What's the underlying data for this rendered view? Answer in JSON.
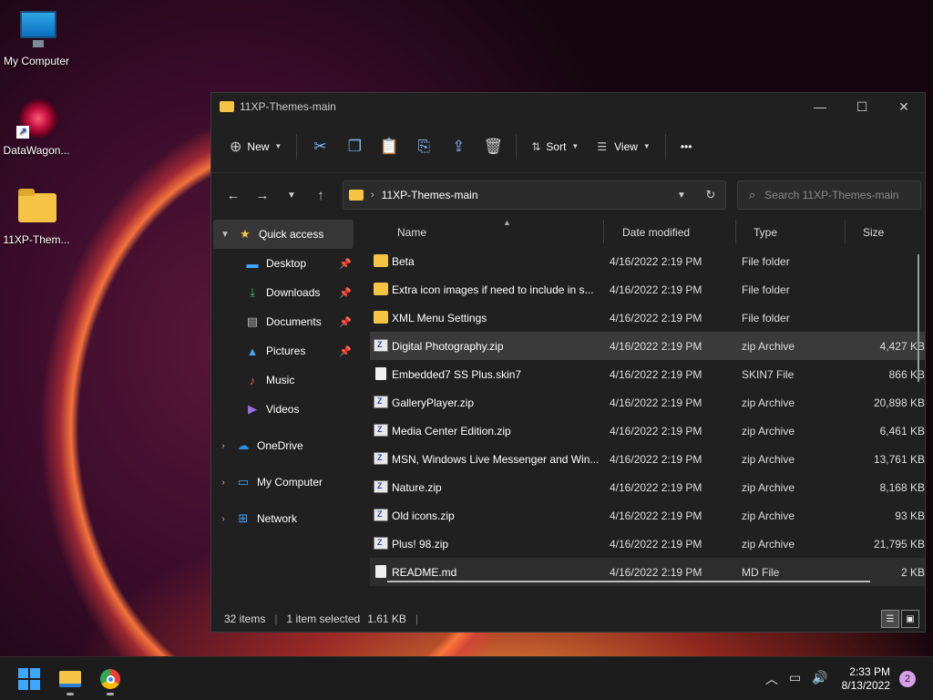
{
  "desktop": {
    "icons": [
      {
        "label": "My Computer"
      },
      {
        "label": "DataWagon..."
      },
      {
        "label": "11XP-Them..."
      }
    ]
  },
  "window": {
    "title": "11XP-Themes-main",
    "controls": {
      "minimize": "—",
      "maximize": "☐",
      "close": "✕"
    }
  },
  "toolbar": {
    "new_label": "New",
    "sort_label": "Sort",
    "view_label": "View",
    "more_label": "•••"
  },
  "address": {
    "path": "11XP-Themes-main",
    "search_placeholder": "Search 11XP-Themes-main"
  },
  "nav": {
    "quick_access": "Quick access",
    "pinned": [
      {
        "label": "Desktop"
      },
      {
        "label": "Downloads"
      },
      {
        "label": "Documents"
      },
      {
        "label": "Pictures"
      },
      {
        "label": "Music"
      },
      {
        "label": "Videos"
      }
    ],
    "onedrive": "OneDrive",
    "my_computer": "My Computer",
    "network": "Network"
  },
  "columns": {
    "name": "Name",
    "date": "Date modified",
    "type": "Type",
    "size": "Size"
  },
  "files": [
    {
      "name": "Beta",
      "date": "4/16/2022 2:19 PM",
      "type": "File folder",
      "size": ""
    },
    {
      "name": "Extra icon  images if need to include in s...",
      "date": "4/16/2022 2:19 PM",
      "type": "File folder",
      "size": ""
    },
    {
      "name": "XML Menu Settings",
      "date": "4/16/2022 2:19 PM",
      "type": "File folder",
      "size": ""
    },
    {
      "name": "Digital Photography.zip",
      "date": "4/16/2022 2:19 PM",
      "type": "zip Archive",
      "size": "4,427 KB"
    },
    {
      "name": "Embedded7 SS Plus.skin7",
      "date": "4/16/2022 2:19 PM",
      "type": "SKIN7 File",
      "size": "866 KB"
    },
    {
      "name": "GalleryPlayer.zip",
      "date": "4/16/2022 2:19 PM",
      "type": "zip Archive",
      "size": "20,898 KB"
    },
    {
      "name": "Media Center Edition.zip",
      "date": "4/16/2022 2:19 PM",
      "type": "zip Archive",
      "size": "6,461 KB"
    },
    {
      "name": "MSN, Windows Live Messenger and Win...",
      "date": "4/16/2022 2:19 PM",
      "type": "zip Archive",
      "size": "13,761 KB"
    },
    {
      "name": "Nature.zip",
      "date": "4/16/2022 2:19 PM",
      "type": "zip Archive",
      "size": "8,168 KB"
    },
    {
      "name": "Old icons.zip",
      "date": "4/16/2022 2:19 PM",
      "type": "zip Archive",
      "size": "93 KB"
    },
    {
      "name": "Plus! 98.zip",
      "date": "4/16/2022 2:19 PM",
      "type": "zip Archive",
      "size": "21,795 KB"
    },
    {
      "name": "README.md",
      "date": "4/16/2022 2:19 PM",
      "type": "MD File",
      "size": "2 KB"
    }
  ],
  "status": {
    "items": "32 items",
    "selected": "1 item selected",
    "size": "1.61 KB"
  },
  "taskbar": {
    "time": "2:33 PM",
    "date": "8/13/2022",
    "notifications": "2"
  }
}
